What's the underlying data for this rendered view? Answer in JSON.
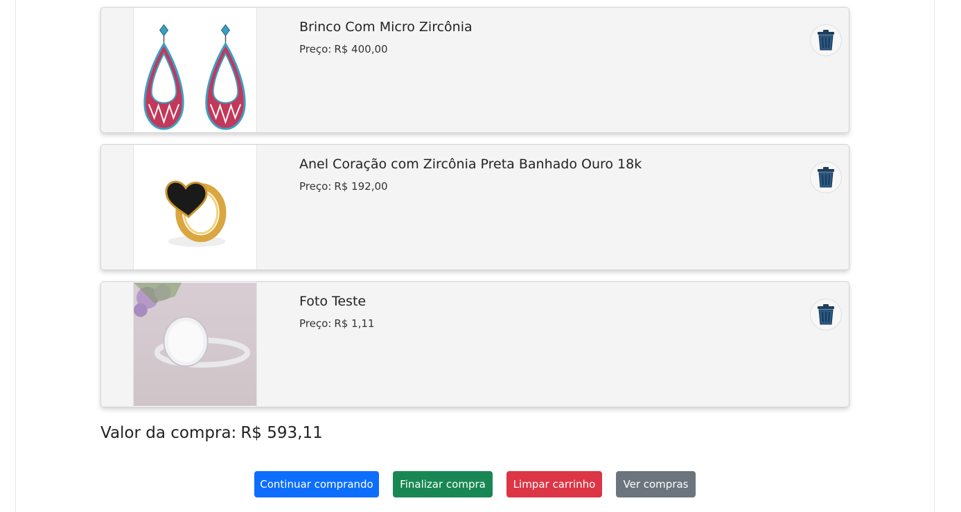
{
  "cart": {
    "price_label": "Preço:",
    "items": [
      {
        "name": "Brinco Com Micro Zircônia",
        "price": "R$ 400,00",
        "image": "earrings-image"
      },
      {
        "name": "Anel Coração com Zircônia Preta Banhado Ouro 18k",
        "price": "R$ 192,00",
        "image": "heart-ring-image"
      },
      {
        "name": "Foto Teste",
        "price": "R$ 1,11",
        "image": "signet-ring-image"
      }
    ],
    "delete_icon": "trash-icon"
  },
  "summary": {
    "total_label": "Valor da compra:",
    "total_value": "R$ 593,11"
  },
  "actions": {
    "continue_label": "Continuar comprando",
    "finish_label": "Finalizar compra",
    "clear_label": "Limpar carrinho",
    "history_label": "Ver compras"
  },
  "colors": {
    "primary": "#0d6efd",
    "success": "#198754",
    "danger": "#dc3545",
    "secondary": "#6c757d",
    "card_bg": "#f4f4f4",
    "trash_icon": "#2b4f73"
  }
}
